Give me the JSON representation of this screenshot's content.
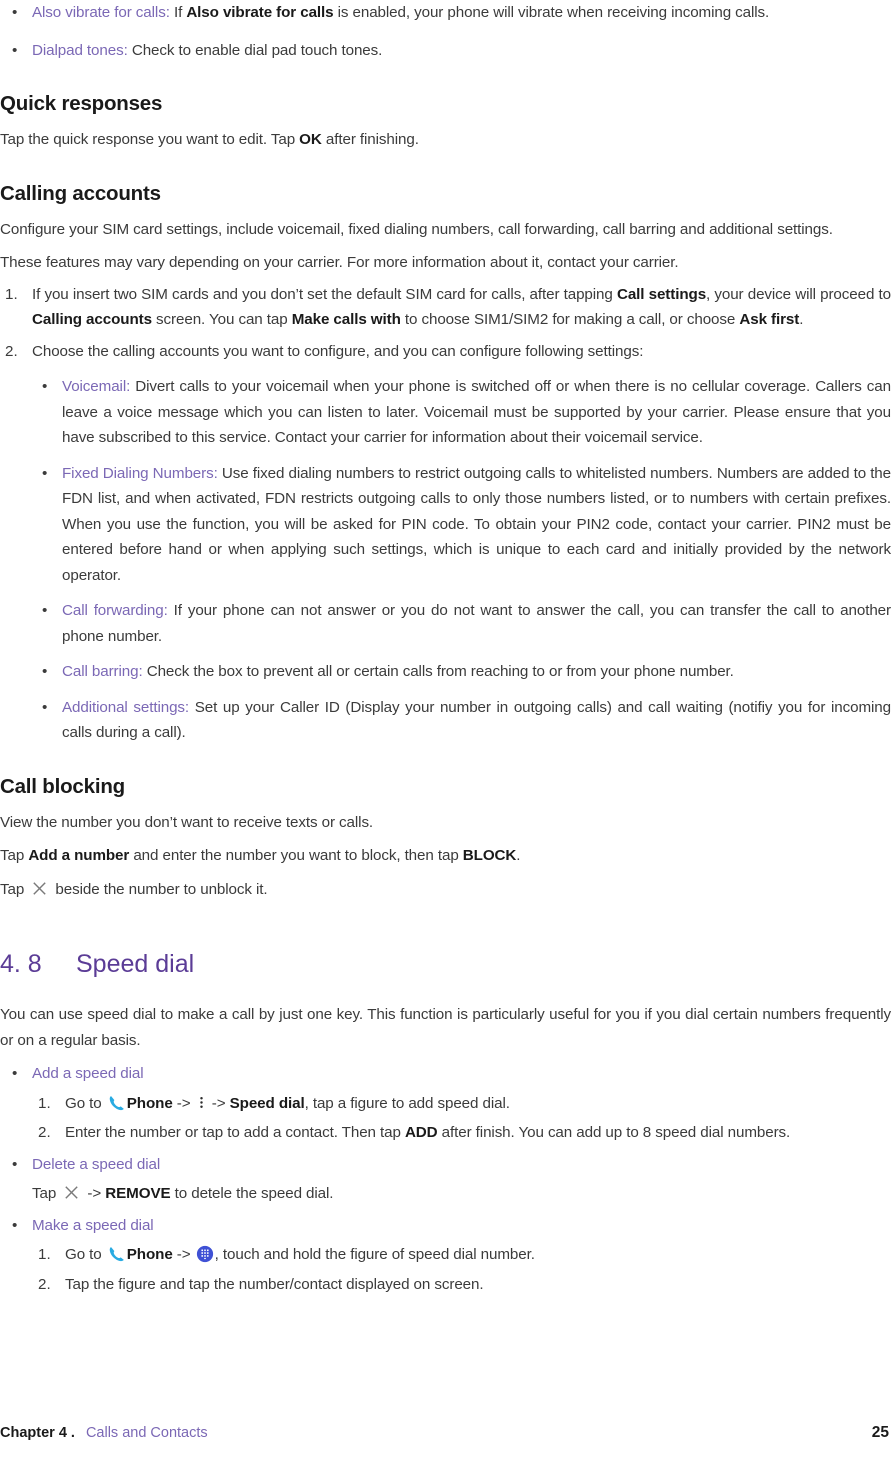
{
  "document": {
    "type": "user-manual-page",
    "colors": {
      "link_purple": "#7B68B5",
      "heading_purple": "#5B3C96",
      "body_text": "#3b3b3b",
      "bold_text": "#1a1a1a",
      "phone_icon_blue": "#29ABE2",
      "dialpad_icon_blue": "#3F51D5"
    }
  },
  "top_bullets": [
    {
      "term": "Also vibrate for calls:",
      "text_before_bold": " If ",
      "bold": "Also vibrate for calls",
      "text_after": " is enabled, your phone will vibrate when receiving incoming calls."
    },
    {
      "term": "Dialpad tones:",
      "text": " Check to enable dial pad touch tones."
    }
  ],
  "quick_responses": {
    "heading": "Quick responses",
    "body_before": "Tap the quick response you want to edit. Tap ",
    "bold": "OK",
    "body_after": " after finishing."
  },
  "calling_accounts": {
    "heading": "Calling accounts",
    "intro": "Configure your SIM card settings, include voicemail, fixed dialing numbers, call forwarding, call barring and additional settings.",
    "note": "These features may vary depending on your carrier. For more information about it, contact your carrier.",
    "step1": {
      "index": "1.",
      "p1": "If you insert two SIM cards and you don’t set the default SIM card for calls, after tapping ",
      "b1": "Call settings",
      "p2": ", your device will proceed to ",
      "b2": "Calling accounts",
      "p3": " screen. You can tap ",
      "b3": "Make calls with",
      "p4": " to choose SIM1/SIM2 for making a call, or choose ",
      "b4": "Ask first",
      "p5": "."
    },
    "step2": {
      "index": "2.",
      "text": "Choose the calling accounts you want to configure, and you can configure following settings:"
    },
    "sub_bullets": [
      {
        "term": "Voicemail:",
        "text": " Divert calls to your voicemail when your phone is switched off or when there is no cellular coverage. Callers can leave a voice message which you can listen to later. Voicemail must be supported by your carrier. Please ensure that you have subscribed to this service. Contact your carrier for information about their voicemail service."
      },
      {
        "term": "Fixed Dialing Numbers:",
        "text": " Use fixed dialing numbers to restrict outgoing calls to whitelisted numbers. Numbers are added to the FDN list, and when activated, FDN restricts outgoing calls to only those numbers listed, or to numbers with certain prefixes. When you use the function, you will be asked for PIN code. To obtain your PIN2 code, contact your carrier. PIN2 must be entered before hand or when applying such settings, which is unique to each card and initially provided by the network operator."
      },
      {
        "term": "Call forwarding:",
        "text": " If your phone can not answer or you do not want to answer the call, you can transfer the call to another phone number."
      },
      {
        "term": "Call barring:",
        "text": " Check the box to prevent all or certain calls from reaching to or from your phone number."
      },
      {
        "term": "Additional settings:",
        "text": " Set up your Caller ID (Display your number in outgoing calls) and call waiting (notifiy you for incoming calls during a call)."
      }
    ]
  },
  "call_blocking": {
    "heading": "Call blocking",
    "line1": "View the number you don’t want to receive texts or calls.",
    "line2": {
      "p1": "Tap ",
      "b1": "Add a number",
      "p2": " and enter the number you want to block, then tap ",
      "b2": "BLOCK",
      "p3": "."
    },
    "line3": {
      "p1": "Tap ",
      "icon": "close-x-icon",
      "p2": " beside the number to unblock it."
    }
  },
  "speed_dial": {
    "number": "4. 8",
    "title": "Speed dial",
    "intro": "You can use speed dial to make a call by just one key. This function is particularly useful for you if you dial certain numbers frequently or on a regular basis.",
    "add": {
      "label": "Add a speed dial",
      "steps": [
        {
          "index": "1.",
          "p1": "Go to ",
          "icon1": "phone-icon",
          "b1": "Phone",
          "p2": " -> ",
          "icon2": "kebab-menu-icon",
          "p3": " -> ",
          "b2": "Speed dial",
          "p4": ", tap a figure to add speed dial."
        },
        {
          "index": "2.",
          "p1": "Enter the number or tap to add a contact. Then tap ",
          "b1": "ADD",
          "p2": " after finish. You can add up to 8 speed dial numbers."
        }
      ]
    },
    "delete": {
      "label": "Delete a speed dial",
      "line": {
        "p1": "Tap ",
        "icon": "close-x-icon",
        "p2": " -> ",
        "b1": "REMOVE",
        "p3": " to detele the speed dial."
      }
    },
    "make": {
      "label": "Make a speed dial",
      "steps": [
        {
          "index": "1.",
          "p1": "Go to ",
          "icon1": "phone-icon",
          "b1": "Phone",
          "p2": " -> ",
          "icon2": "dialpad-icon",
          "p3": ", touch and hold the figure of speed dial number."
        },
        {
          "index": "2.",
          "p1": "Tap the figure and tap the number/contact displayed on screen."
        }
      ]
    }
  },
  "footer": {
    "chapter": "Chapter 4 .",
    "subtitle": "Calls and Contacts",
    "page_number": "25"
  },
  "bullet_glyph": "•"
}
